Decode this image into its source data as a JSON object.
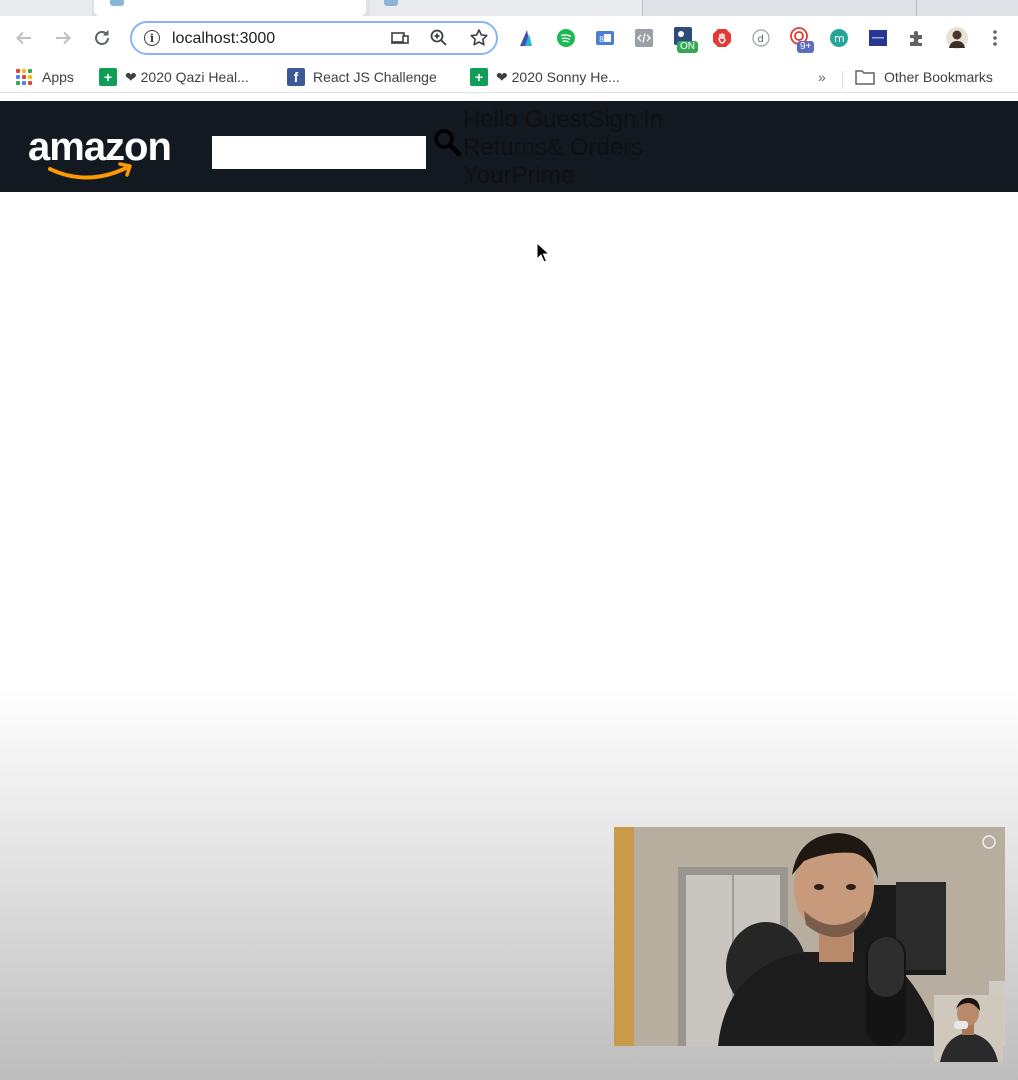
{
  "browser": {
    "url": "localhost:3000",
    "bookmarks": [
      {
        "label": "Apps",
        "icon": "apps-grid-icon"
      },
      {
        "label": "❤ 2020 Qazi Heal...",
        "icon": "google-sheets-icon"
      },
      {
        "label": "React JS Challenge",
        "icon": "facebook-icon"
      },
      {
        "label": "❤ 2020 Sonny He...",
        "icon": "google-sheets-icon"
      }
    ],
    "bookmarks_overflow": "»",
    "other_bookmarks": "Other Bookmarks",
    "extension_badges": {
      "on": "ON",
      "count": "9+"
    },
    "colors": {
      "focus_ring": "#8ab4f8",
      "toolbar_bg": "#ffffff",
      "tabstrip_bg": "#dee1e6"
    }
  },
  "amazon": {
    "logo_text": "amazon",
    "search_value": "",
    "nav": {
      "line1": "Hello GuestSign In",
      "line2": "Returns& Orders",
      "line3": "YourPrime"
    },
    "colors": {
      "header_bg": "#131921",
      "smile": "#f90"
    }
  }
}
